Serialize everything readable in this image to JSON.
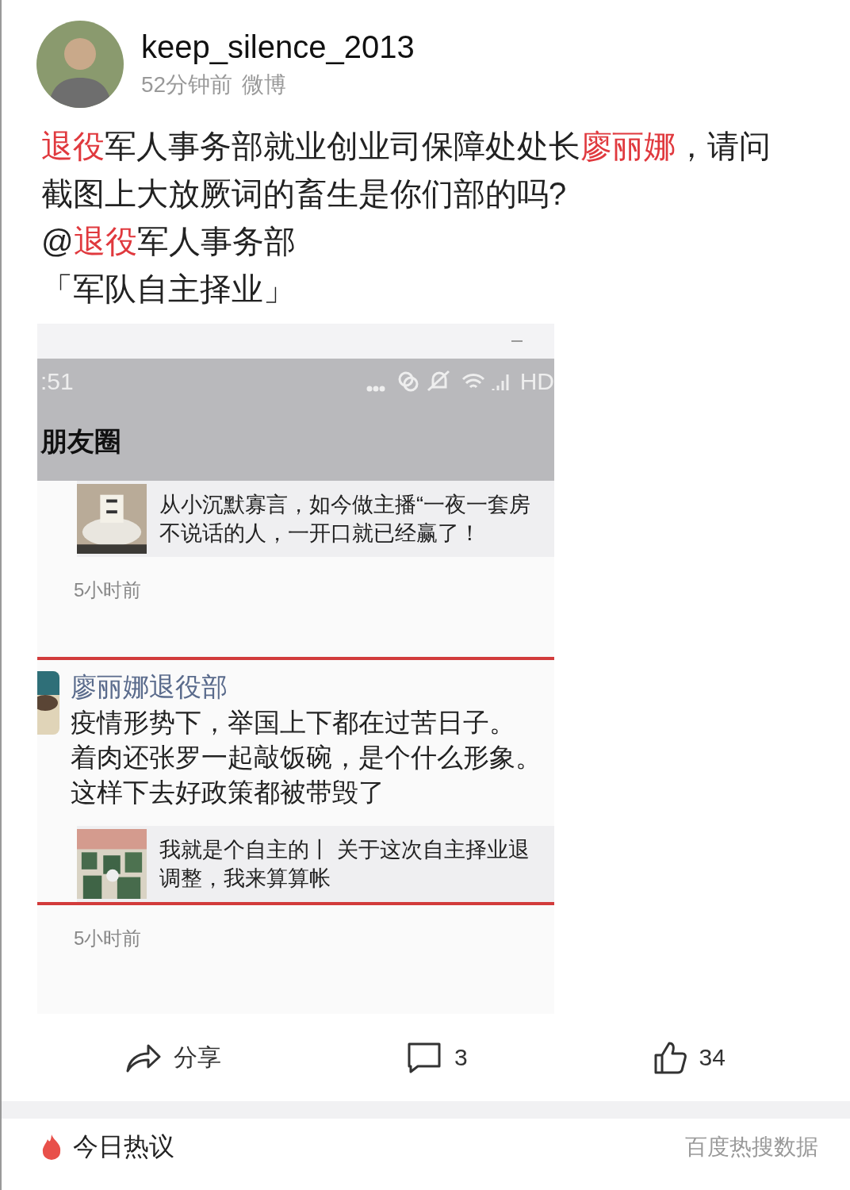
{
  "author": {
    "name": "keep_silence_2013",
    "time": "52分钟前",
    "source": "微博"
  },
  "body": [
    [
      {
        "text": "退役",
        "highlight": true
      },
      {
        "text": "军人事务部就业创业司保障处处长",
        "highlight": false
      },
      {
        "text": "廖丽娜",
        "highlight": true
      },
      {
        "text": "，请问截图上大放厥词的畜生是你们部的吗?",
        "highlight": false
      }
    ],
    [
      {
        "text": "@",
        "highlight": false
      },
      {
        "text": "退役",
        "highlight": true
      },
      {
        "text": "军人事务部",
        "highlight": false
      }
    ],
    [
      {
        "text": "「军队自主择业」",
        "highlight": false
      }
    ]
  ],
  "screenshot": {
    "clock": ":51",
    "network": "HD",
    "title": "朋友圈",
    "moments": [
      {
        "outlined": false,
        "link_lines": [
          "从小沉默寡言，如今做主播“一夜一套房",
          "不说话的人，一开口就已经赢了！"
        ],
        "time": "5小时前"
      },
      {
        "outlined": true,
        "author": "廖丽娜退役部",
        "lines": [
          "疫情形势下，举国上下都在过苦日子。",
          "着肉还张罗一起敲饭碗，是个什么形象。",
          "这样下去好政策都被带毁了"
        ],
        "link_lines": [
          "我就是个自主的丨 关于这次自主择业退",
          "调整，我来算算帐"
        ],
        "time": "5小时前"
      }
    ]
  },
  "actions": [
    {
      "kind": "share",
      "label": "分享"
    },
    {
      "kind": "comment",
      "label": "3"
    },
    {
      "kind": "like",
      "label": "34"
    }
  ],
  "hot": {
    "title": "今日热议",
    "source": "百度热搜数据"
  }
}
